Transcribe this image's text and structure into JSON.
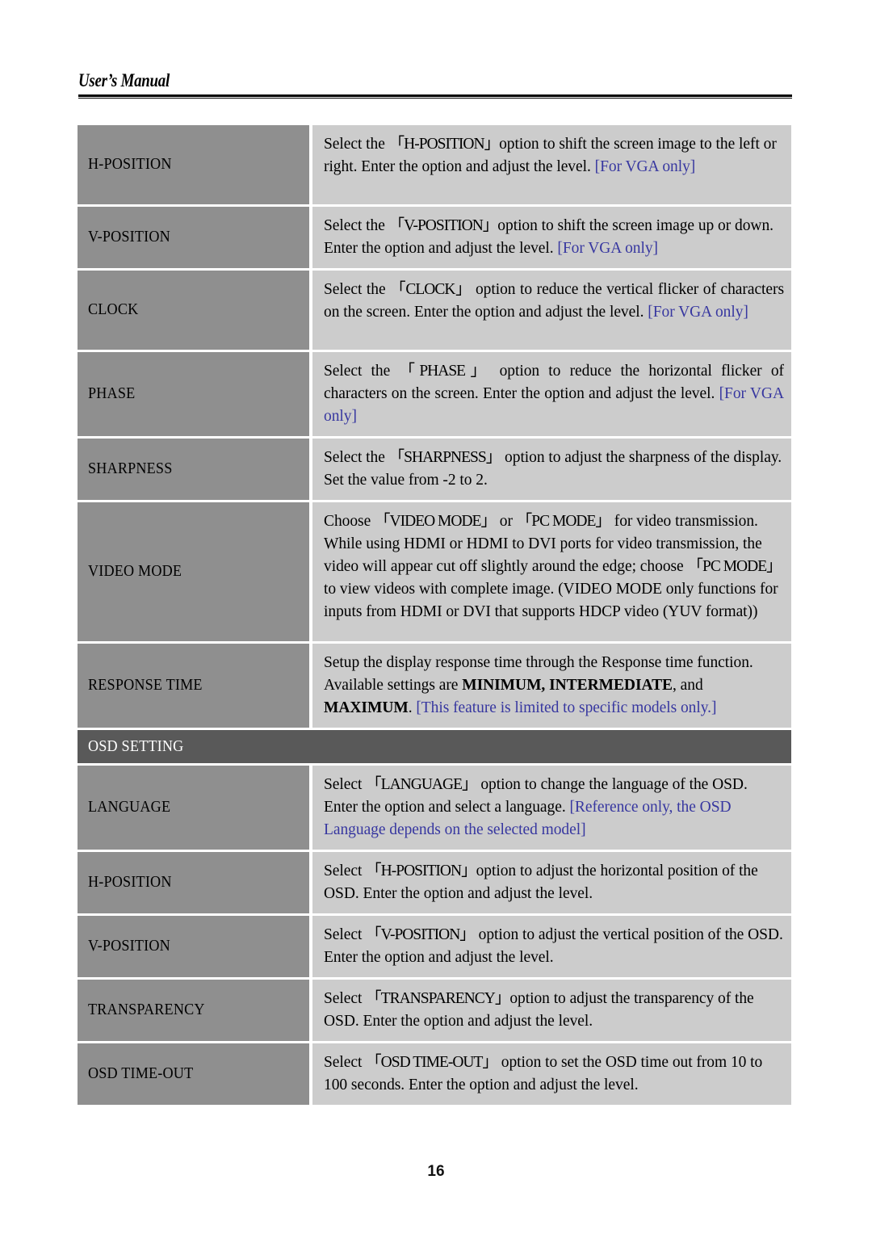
{
  "header": {
    "title": "User’s Manual"
  },
  "footer": {
    "page_number": "16"
  },
  "colors": {
    "label_cell_bg": "#8f8f8f",
    "desc_cell_bg": "#cccccc",
    "section_bar_bg": "#595959",
    "note_text": "#3737a0",
    "page_bg": "#ffffff"
  },
  "table": {
    "rows": [
      {
        "type": "entry",
        "label": "H-POSITION",
        "desc_plain": "Select the 「H-POSITION」option to shift the screen image to the left or right. Enter the option and adjust the level. [For VGA only]",
        "desc_parts": [
          {
            "text": "Select the ",
            "style": "normal"
          },
          {
            "text": "「H-POSITION」",
            "style": "bracket"
          },
          {
            "text": "option to shift the screen image to the left or right. Enter the option and adjust the level. ",
            "style": "normal"
          },
          {
            "text": "[For VGA only]",
            "style": "note"
          }
        ]
      },
      {
        "type": "entry",
        "label": "V-POSITION",
        "desc_plain": "Select the 「V-POSITION」option to shift the screen image up or down. Enter the option and adjust the level. [For VGA only]",
        "desc_parts": [
          {
            "text": "Select the ",
            "style": "normal"
          },
          {
            "text": "「V-POSITION」",
            "style": "bracket"
          },
          {
            "text": "option to shift the screen image up or down. Enter the option and adjust the level. ",
            "style": "normal"
          },
          {
            "text": "[For VGA only]",
            "style": "note"
          }
        ]
      },
      {
        "type": "entry",
        "label": "CLOCK",
        "desc_plain": "Select the 「CLOCK」option to reduce the vertical flicker of characters on the screen. Enter the option and adjust the level. [For VGA only]",
        "desc_parts": [
          {
            "text": "Select the ",
            "style": "normal"
          },
          {
            "text": "「CLOCK」",
            "style": "bracket"
          },
          {
            "text": " option to reduce the vertical flicker of characters on the screen. Enter the option and adjust the level. ",
            "style": "normal"
          },
          {
            "text": "[For VGA only]",
            "style": "note"
          }
        ]
      },
      {
        "type": "entry",
        "label": "PHASE",
        "desc_plain": "Select the 「PHASE」option to reduce the horizontal flicker of characters on the screen. Enter the option and adjust the level. [For VGA only]",
        "desc_parts": [
          {
            "text": "Select the ",
            "style": "normal"
          },
          {
            "text": "「PHASE」",
            "style": "bracket"
          },
          {
            "text": " option to reduce the horizontal flicker of characters on the screen. Enter the option and adjust the level. ",
            "style": "normal"
          },
          {
            "text": "[For VGA only]",
            "style": "note"
          }
        ]
      },
      {
        "type": "entry",
        "label": "SHARPNESS",
        "desc_plain": "Select the 「SHARPNESS」option to adjust the sharpness of the display. Set the value from -2 to 2.",
        "desc_parts": [
          {
            "text": "Select the ",
            "style": "normal"
          },
          {
            "text": "「SHARPNESS」",
            "style": "bracket"
          },
          {
            "text": " option to adjust the sharpness of the display. Set the value from -2 to 2.",
            "style": "normal"
          }
        ]
      },
      {
        "type": "entry",
        "label": "VIDEO MODE",
        "desc_plain": "Choose 「VIDEO MODE」 or 「PC MODE」 for video transmission. While using HDMI or HDMI to DVI ports for video transmission, the video will appear cut off slightly around the edge; choose 「PC MODE」 to view videos with complete image. (VIDEO MODE only functions for inputs from HDMI or DVI that supports HDCP video (YUV format))",
        "desc_parts": [
          {
            "text": "Choose ",
            "style": "normal"
          },
          {
            "text": "「VIDEO MODE」",
            "style": "bracket"
          },
          {
            "text": " or ",
            "style": "normal"
          },
          {
            "text": " 「PC MODE」",
            "style": "bracket"
          },
          {
            "text": " for video transmission. While using HDMI or HDMI to DVI ports for video transmission, the video will appear cut off slightly around the edge; choose ",
            "style": "normal"
          },
          {
            "text": "「PC MODE」",
            "style": "bracket"
          },
          {
            "text": " to view videos with complete image. (VIDEO MODE only functions for inputs from HDMI or DVI that supports HDCP video (YUV format))",
            "style": "normal"
          }
        ]
      },
      {
        "type": "entry",
        "label": "RESPONSE TIME",
        "desc_plain": "Setup the display response time through the Response time function. Available settings are MINIMUM, INTERMEDIATE, and MAXIMUM. [This feature is limited to specific models only.]",
        "desc_parts": [
          {
            "text": "Setup the display response time through the Response time function. Available settings are ",
            "style": "normal"
          },
          {
            "text": "MINIMUM,",
            "style": "bold"
          },
          {
            "text": " ",
            "style": "normal"
          },
          {
            "text": "INTERMEDIATE",
            "style": "bold"
          },
          {
            "text": ", and ",
            "style": "normal"
          },
          {
            "text": "MAXIMUM",
            "style": "bold"
          },
          {
            "text": ". ",
            "style": "normal"
          },
          {
            "text": "[This feature is limited to specific models only.]",
            "style": "note"
          }
        ]
      },
      {
        "type": "section",
        "label": "OSD SETTING"
      },
      {
        "type": "entry",
        "label": "LANGUAGE",
        "desc_plain": "Select 「LANGUAGE」 option to change the language of the OSD. Enter the option and select a language. [Reference only, the OSD Language depends on the selected model]",
        "desc_parts": [
          {
            "text": "Select ",
            "style": "normal"
          },
          {
            "text": "「LANGUAGE」",
            "style": "bracket"
          },
          {
            "text": " option to change the language of the OSD. Enter the option and select a language. ",
            "style": "normal"
          },
          {
            "text": "[Reference only, the OSD Language depends on the selected model]",
            "style": "note"
          }
        ]
      },
      {
        "type": "entry",
        "label": "H-POSITION",
        "desc_plain": "Select 「H-POSITION」option to adjust the horizontal position of the OSD. Enter the option and adjust the level.",
        "desc_parts": [
          {
            "text": "Select ",
            "style": "normal"
          },
          {
            "text": "「H-POSITION」",
            "style": "bracket"
          },
          {
            "text": "option to adjust the horizontal position of the OSD. Enter the option and adjust the level.",
            "style": "normal"
          }
        ]
      },
      {
        "type": "entry",
        "label": "V-POSITION",
        "desc_plain": "Select 「V-POSITION」 option to adjust the vertical position of the OSD. Enter the option and adjust the level.",
        "desc_parts": [
          {
            "text": "Select ",
            "style": "normal"
          },
          {
            "text": "「V-POSITION」",
            "style": "bracket"
          },
          {
            "text": " option to adjust the vertical position of the OSD. Enter the option and adjust the level.",
            "style": "normal"
          }
        ]
      },
      {
        "type": "entry",
        "label": "TRANSPARENCY",
        "desc_plain": "Select 「TRANSPARENCY」option to adjust the transparency of the OSD. Enter the option and adjust the level.",
        "desc_parts": [
          {
            "text": "Select ",
            "style": "normal"
          },
          {
            "text": "「TRANSPARENCY」",
            "style": "bracket"
          },
          {
            "text": "option to adjust the transparency of the OSD. Enter the option and adjust the level.",
            "style": "normal"
          }
        ]
      },
      {
        "type": "entry",
        "label": "OSD TIME-OUT",
        "desc_plain": "Select 「OSD TIME-OUT」 option to set the OSD time out from 10 to 100 seconds. Enter the option and adjust the level.",
        "desc_parts": [
          {
            "text": "Select ",
            "style": "normal"
          },
          {
            "text": "「OSD TIME-OUT」",
            "style": "bracket"
          },
          {
            "text": " option to set the OSD time out from 10 to 100 seconds. Enter the option and adjust the level.",
            "style": "normal"
          }
        ]
      }
    ]
  }
}
